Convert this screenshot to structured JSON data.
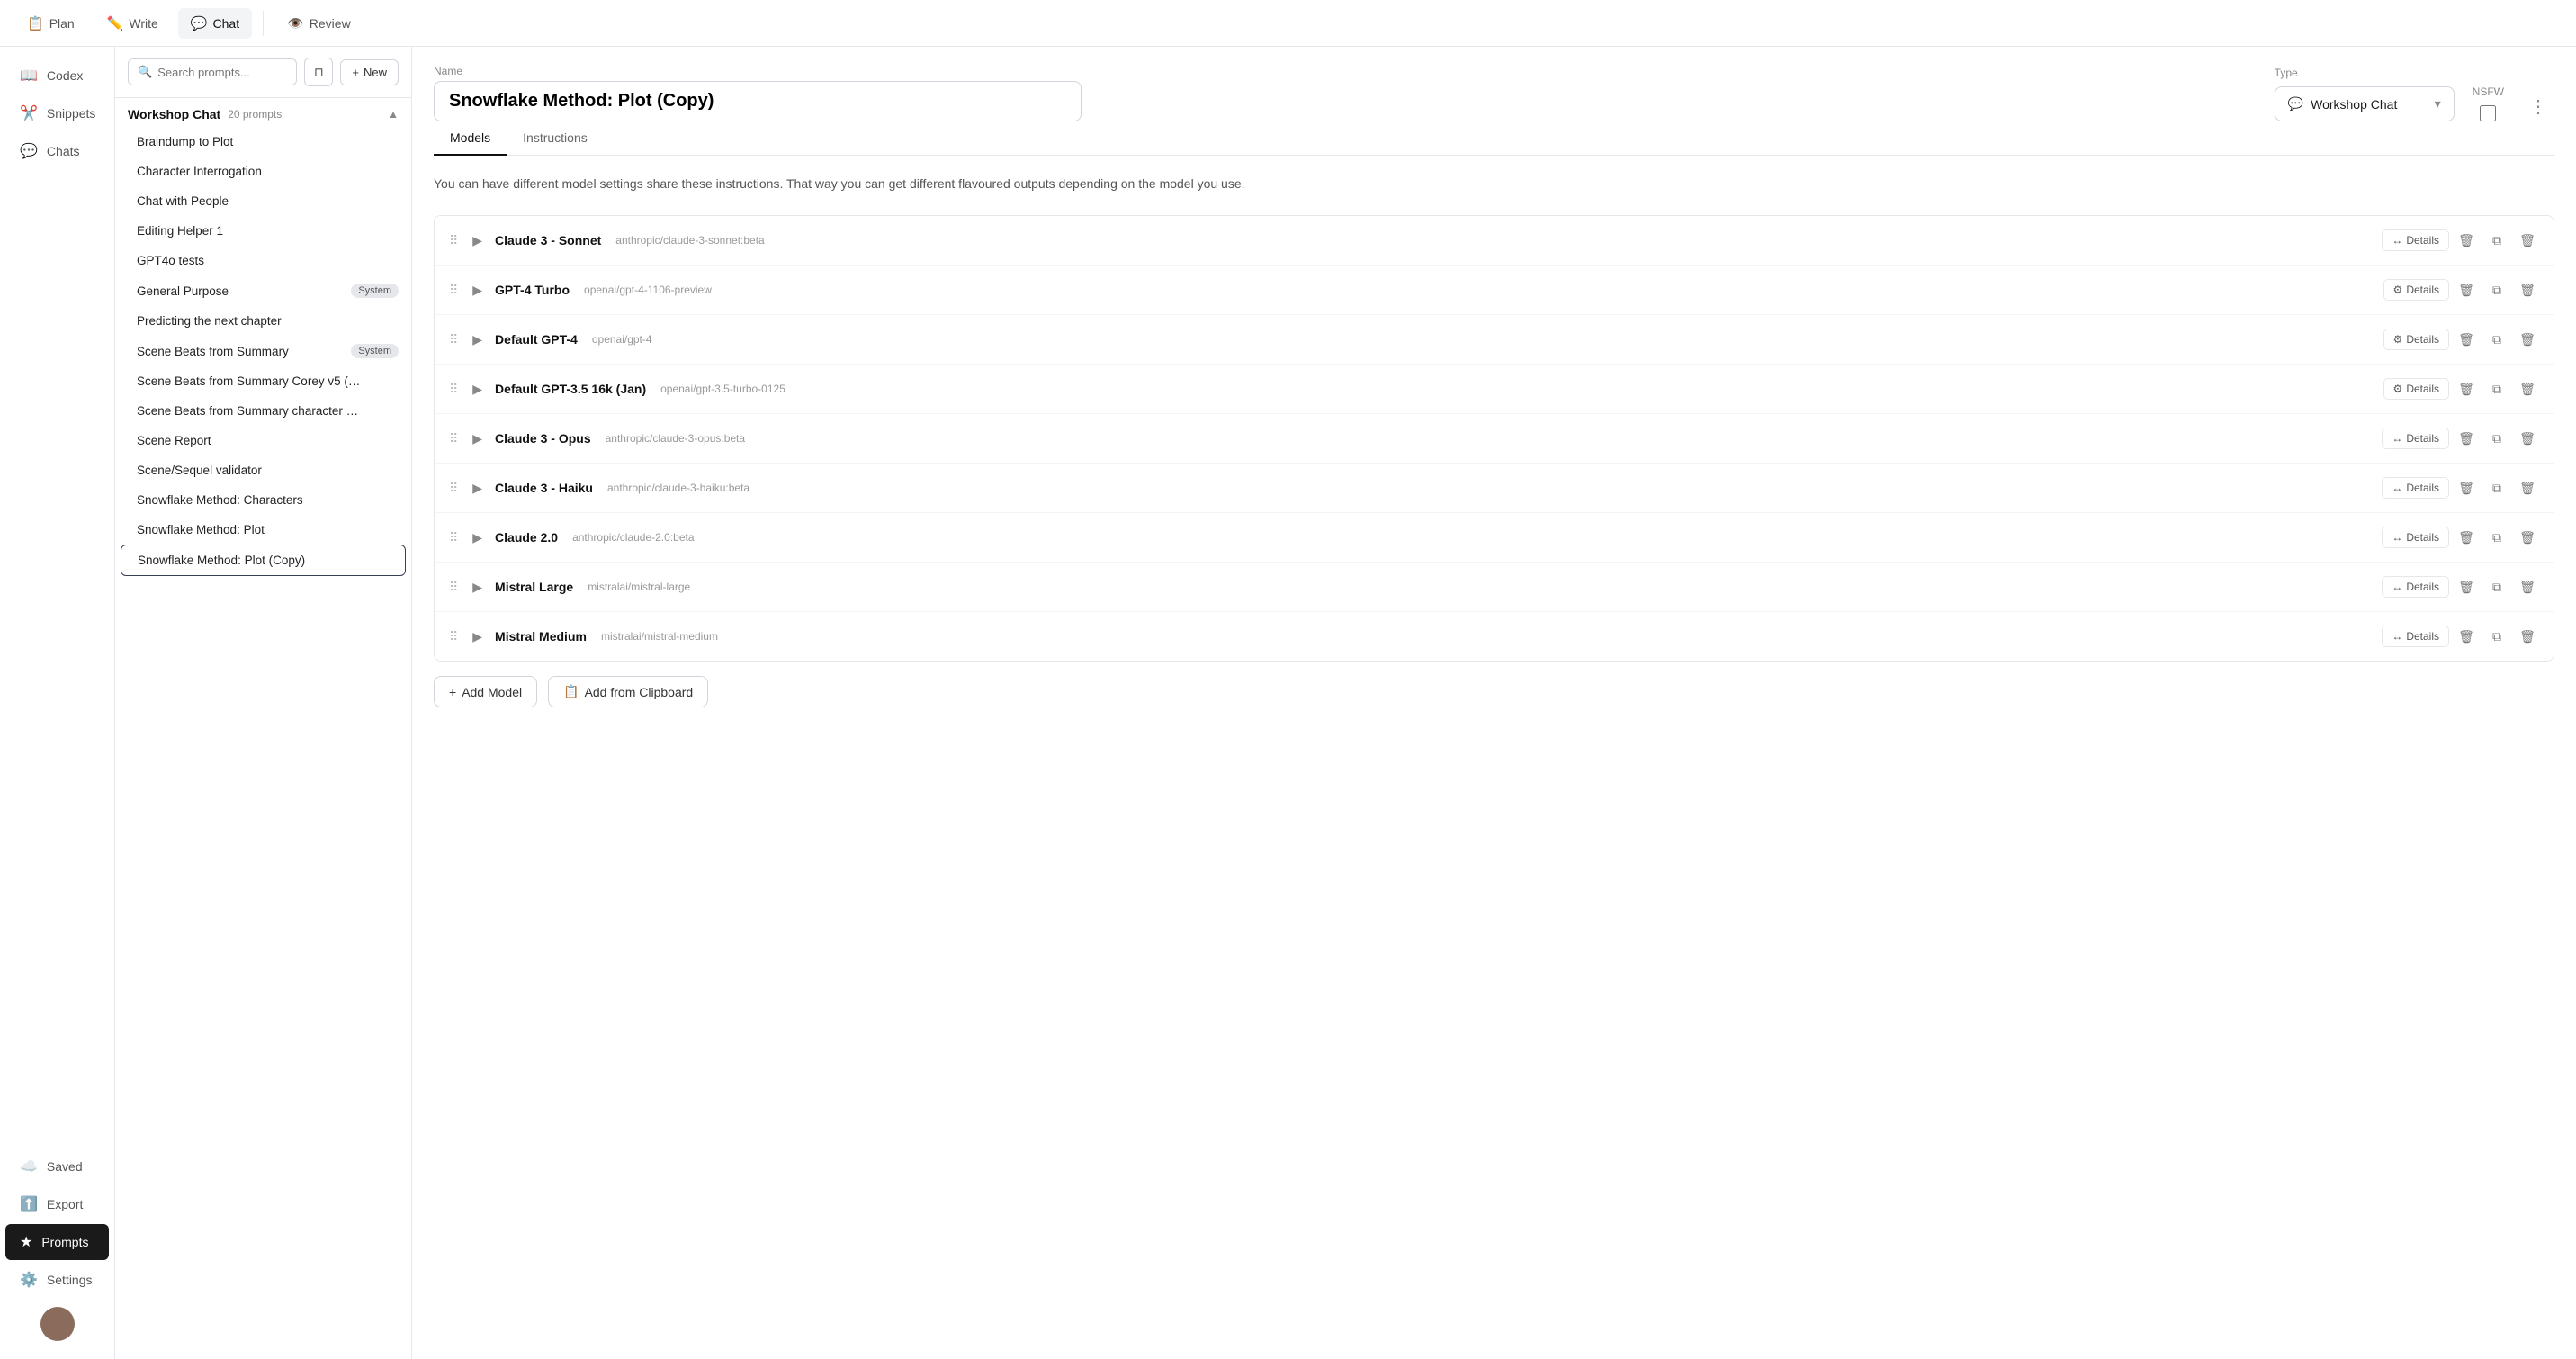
{
  "topNav": {
    "tabs": [
      {
        "id": "plan",
        "label": "Plan",
        "icon": "📋",
        "active": false
      },
      {
        "id": "write",
        "label": "Write",
        "icon": "✏️",
        "active": false
      },
      {
        "id": "chat",
        "label": "Chat",
        "icon": "💬",
        "active": true
      },
      {
        "id": "review",
        "label": "Review",
        "icon": "👁️",
        "active": false
      }
    ]
  },
  "sidebar": {
    "items": [
      {
        "id": "codex",
        "label": "Codex",
        "icon": "📖",
        "active": false
      },
      {
        "id": "snippets",
        "label": "Snippets",
        "icon": "✂️",
        "active": false
      },
      {
        "id": "chats",
        "label": "Chats",
        "icon": "💬",
        "active": false
      },
      {
        "id": "saved",
        "label": "Saved",
        "icon": "☁️",
        "active": false
      },
      {
        "id": "export",
        "label": "Export",
        "icon": "⬆️",
        "active": false
      },
      {
        "id": "prompts",
        "label": "Prompts",
        "icon": "★",
        "active": true
      },
      {
        "id": "settings",
        "label": "Settings",
        "icon": "⚙️",
        "active": false
      }
    ]
  },
  "promptsPanel": {
    "searchPlaceholder": "Search prompts...",
    "newLabel": "New",
    "group": {
      "name": "Workshop Chat",
      "count": "20 prompts",
      "collapsed": false
    },
    "prompts": [
      {
        "id": "braindump",
        "label": "Braindump to Plot",
        "badge": null
      },
      {
        "id": "char-int",
        "label": "Character Interrogation",
        "badge": null
      },
      {
        "id": "chat-people",
        "label": "Chat with People",
        "badge": null
      },
      {
        "id": "editing-helper",
        "label": "Editing Helper 1",
        "badge": null
      },
      {
        "id": "gpt4o-tests",
        "label": "GPT4o tests",
        "badge": null
      },
      {
        "id": "general-purpose",
        "label": "General Purpose",
        "badge": "System"
      },
      {
        "id": "predicting",
        "label": "Predicting the next chapter",
        "badge": null
      },
      {
        "id": "scene-beats-summary",
        "label": "Scene Beats from Summary",
        "badge": "System"
      },
      {
        "id": "scene-beats-corey",
        "label": "Scene Beats from Summary Corey v5 (…",
        "badge": null
      },
      {
        "id": "scene-beats-char",
        "label": "Scene Beats from Summary character …",
        "badge": null
      },
      {
        "id": "scene-report",
        "label": "Scene Report",
        "badge": null
      },
      {
        "id": "scene-validator",
        "label": "Scene/Sequel validator",
        "badge": null
      },
      {
        "id": "snowflake-chars",
        "label": "Snowflake Method: Characters",
        "badge": null
      },
      {
        "id": "snowflake-plot",
        "label": "Snowflake Method: Plot",
        "badge": null
      },
      {
        "id": "snowflake-copy",
        "label": "Snowflake Method: Plot (Copy)",
        "badge": null,
        "selected": true
      }
    ]
  },
  "mainContent": {
    "nameLabel": "Name",
    "typeLabel": "Type",
    "nsfwLabel": "NSFW",
    "titleValue": "Snowflake Method: Plot (Copy)",
    "typeIcon": "💬",
    "typeValue": "Workshop Chat",
    "tabs": [
      {
        "id": "models",
        "label": "Models",
        "active": true
      },
      {
        "id": "instructions",
        "label": "Instructions",
        "active": false
      }
    ],
    "infoText": "You can have different model settings share these instructions. That way you can get different flavoured outputs depending on the model you use.",
    "models": [
      {
        "id": "claude3-sonnet",
        "name": "Claude 3 - Sonnet",
        "modelId": "anthropic/claude-3-sonnet:beta",
        "detailIcon": "↔️"
      },
      {
        "id": "gpt4-turbo",
        "name": "GPT-4 Turbo",
        "modelId": "openai/gpt-4-1106-preview",
        "detailIcon": "⚙️"
      },
      {
        "id": "default-gpt4",
        "name": "Default GPT-4",
        "modelId": "openai/gpt-4",
        "detailIcon": "⚙️"
      },
      {
        "id": "gpt35-16k",
        "name": "Default GPT-3.5 16k (Jan)",
        "modelId": "openai/gpt-3.5-turbo-0125",
        "detailIcon": "⚙️"
      },
      {
        "id": "claude3-opus",
        "name": "Claude 3 - Opus",
        "modelId": "anthropic/claude-3-opus:beta",
        "detailIcon": "↔️"
      },
      {
        "id": "claude3-haiku",
        "name": "Claude 3 - Haiku",
        "modelId": "anthropic/claude-3-haiku:beta",
        "detailIcon": "↔️"
      },
      {
        "id": "claude20",
        "name": "Claude 2.0",
        "modelId": "anthropic/claude-2.0:beta",
        "detailIcon": "↔️"
      },
      {
        "id": "mistral-large",
        "name": "Mistral Large",
        "modelId": "mistralai/mistral-large",
        "detailIcon": "↔️"
      },
      {
        "id": "mistral-medium",
        "name": "Mistral Medium",
        "modelId": "mistralai/mistral-medium",
        "detailIcon": "↔️"
      }
    ],
    "addModelLabel": "Add Model",
    "addClipboardLabel": "Add from Clipboard",
    "detailLabel": "Details"
  }
}
